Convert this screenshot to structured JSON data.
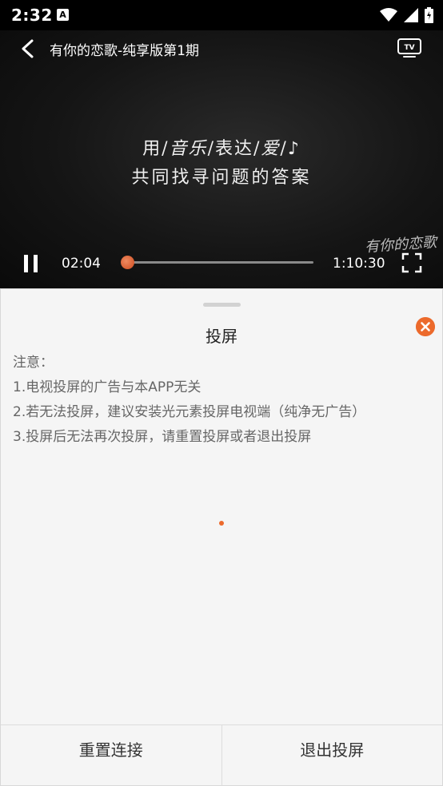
{
  "status_bar": {
    "time": "2:32",
    "app_icon_letter": "A"
  },
  "player": {
    "title": "有你的恋歌-纯享版第1期",
    "lyric_line_1_a": "用/",
    "lyric_line_1_b": "音乐",
    "lyric_line_1_c": "/表达/",
    "lyric_line_1_d": "爱",
    "lyric_line_1_e": "/♪",
    "lyric_line_2": "共同找寻问题的答案",
    "watermark": "有你的恋歌",
    "current_time": "02:04",
    "total_time": "1:10:30",
    "progress": 0.0293,
    "accent_color": "#ec6a2c"
  },
  "cast_sheet": {
    "title": "投屏",
    "notice_heading": "注意：",
    "notices": [
      "1.电视投屏的广告与本APP无关",
      "2.若无法投屏，建议安装光元素投屏电视端（纯净无广告）",
      "3.投屏后无法再次投屏，请重置投屏或者退出投屏"
    ],
    "reset_label": "重置连接",
    "exit_label": "退出投屏"
  }
}
